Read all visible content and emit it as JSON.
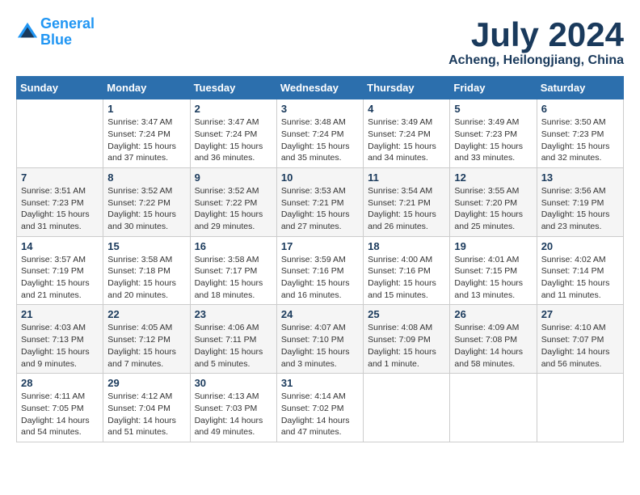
{
  "header": {
    "logo_line1": "General",
    "logo_line2": "Blue",
    "month": "July 2024",
    "location": "Acheng, Heilongjiang, China"
  },
  "weekdays": [
    "Sunday",
    "Monday",
    "Tuesday",
    "Wednesday",
    "Thursday",
    "Friday",
    "Saturday"
  ],
  "weeks": [
    [
      {
        "day": "",
        "info": ""
      },
      {
        "day": "1",
        "info": "Sunrise: 3:47 AM\nSunset: 7:24 PM\nDaylight: 15 hours\nand 37 minutes."
      },
      {
        "day": "2",
        "info": "Sunrise: 3:47 AM\nSunset: 7:24 PM\nDaylight: 15 hours\nand 36 minutes."
      },
      {
        "day": "3",
        "info": "Sunrise: 3:48 AM\nSunset: 7:24 PM\nDaylight: 15 hours\nand 35 minutes."
      },
      {
        "day": "4",
        "info": "Sunrise: 3:49 AM\nSunset: 7:24 PM\nDaylight: 15 hours\nand 34 minutes."
      },
      {
        "day": "5",
        "info": "Sunrise: 3:49 AM\nSunset: 7:23 PM\nDaylight: 15 hours\nand 33 minutes."
      },
      {
        "day": "6",
        "info": "Sunrise: 3:50 AM\nSunset: 7:23 PM\nDaylight: 15 hours\nand 32 minutes."
      }
    ],
    [
      {
        "day": "7",
        "info": "Sunrise: 3:51 AM\nSunset: 7:23 PM\nDaylight: 15 hours\nand 31 minutes."
      },
      {
        "day": "8",
        "info": "Sunrise: 3:52 AM\nSunset: 7:22 PM\nDaylight: 15 hours\nand 30 minutes."
      },
      {
        "day": "9",
        "info": "Sunrise: 3:52 AM\nSunset: 7:22 PM\nDaylight: 15 hours\nand 29 minutes."
      },
      {
        "day": "10",
        "info": "Sunrise: 3:53 AM\nSunset: 7:21 PM\nDaylight: 15 hours\nand 27 minutes."
      },
      {
        "day": "11",
        "info": "Sunrise: 3:54 AM\nSunset: 7:21 PM\nDaylight: 15 hours\nand 26 minutes."
      },
      {
        "day": "12",
        "info": "Sunrise: 3:55 AM\nSunset: 7:20 PM\nDaylight: 15 hours\nand 25 minutes."
      },
      {
        "day": "13",
        "info": "Sunrise: 3:56 AM\nSunset: 7:19 PM\nDaylight: 15 hours\nand 23 minutes."
      }
    ],
    [
      {
        "day": "14",
        "info": "Sunrise: 3:57 AM\nSunset: 7:19 PM\nDaylight: 15 hours\nand 21 minutes."
      },
      {
        "day": "15",
        "info": "Sunrise: 3:58 AM\nSunset: 7:18 PM\nDaylight: 15 hours\nand 20 minutes."
      },
      {
        "day": "16",
        "info": "Sunrise: 3:58 AM\nSunset: 7:17 PM\nDaylight: 15 hours\nand 18 minutes."
      },
      {
        "day": "17",
        "info": "Sunrise: 3:59 AM\nSunset: 7:16 PM\nDaylight: 15 hours\nand 16 minutes."
      },
      {
        "day": "18",
        "info": "Sunrise: 4:00 AM\nSunset: 7:16 PM\nDaylight: 15 hours\nand 15 minutes."
      },
      {
        "day": "19",
        "info": "Sunrise: 4:01 AM\nSunset: 7:15 PM\nDaylight: 15 hours\nand 13 minutes."
      },
      {
        "day": "20",
        "info": "Sunrise: 4:02 AM\nSunset: 7:14 PM\nDaylight: 15 hours\nand 11 minutes."
      }
    ],
    [
      {
        "day": "21",
        "info": "Sunrise: 4:03 AM\nSunset: 7:13 PM\nDaylight: 15 hours\nand 9 minutes."
      },
      {
        "day": "22",
        "info": "Sunrise: 4:05 AM\nSunset: 7:12 PM\nDaylight: 15 hours\nand 7 minutes."
      },
      {
        "day": "23",
        "info": "Sunrise: 4:06 AM\nSunset: 7:11 PM\nDaylight: 15 hours\nand 5 minutes."
      },
      {
        "day": "24",
        "info": "Sunrise: 4:07 AM\nSunset: 7:10 PM\nDaylight: 15 hours\nand 3 minutes."
      },
      {
        "day": "25",
        "info": "Sunrise: 4:08 AM\nSunset: 7:09 PM\nDaylight: 15 hours\nand 1 minute."
      },
      {
        "day": "26",
        "info": "Sunrise: 4:09 AM\nSunset: 7:08 PM\nDaylight: 14 hours\nand 58 minutes."
      },
      {
        "day": "27",
        "info": "Sunrise: 4:10 AM\nSunset: 7:07 PM\nDaylight: 14 hours\nand 56 minutes."
      }
    ],
    [
      {
        "day": "28",
        "info": "Sunrise: 4:11 AM\nSunset: 7:05 PM\nDaylight: 14 hours\nand 54 minutes."
      },
      {
        "day": "29",
        "info": "Sunrise: 4:12 AM\nSunset: 7:04 PM\nDaylight: 14 hours\nand 51 minutes."
      },
      {
        "day": "30",
        "info": "Sunrise: 4:13 AM\nSunset: 7:03 PM\nDaylight: 14 hours\nand 49 minutes."
      },
      {
        "day": "31",
        "info": "Sunrise: 4:14 AM\nSunset: 7:02 PM\nDaylight: 14 hours\nand 47 minutes."
      },
      {
        "day": "",
        "info": ""
      },
      {
        "day": "",
        "info": ""
      },
      {
        "day": "",
        "info": ""
      }
    ]
  ]
}
